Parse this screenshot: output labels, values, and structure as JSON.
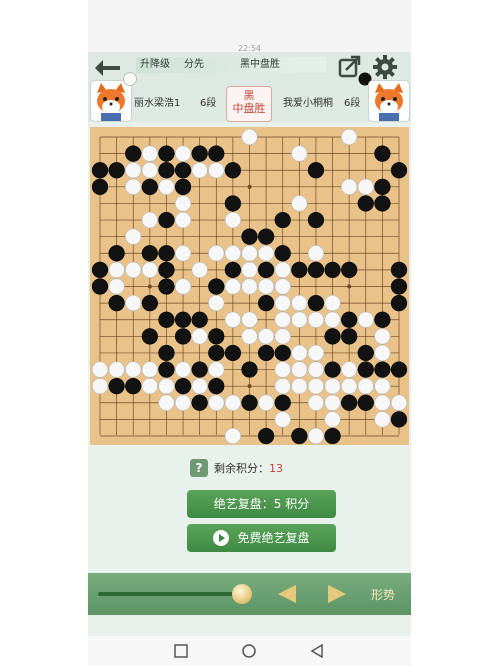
{
  "status": {
    "time": "22:54"
  },
  "header": {
    "rank_label": "升降级",
    "handicap": "分先",
    "result_top": "黑中盘胜",
    "left_player": {
      "name": "丽水梁浩1",
      "rank": "6段",
      "stone": "white"
    },
    "right_player": {
      "name": "我爱小桐桐",
      "rank": "6段",
      "stone": "black"
    },
    "result_stamp": {
      "line1": "黑",
      "line2": "中盘胜"
    },
    "icons": [
      "back-arrow-icon",
      "share-icon",
      "gear-icon",
      "fox-avatar-icon"
    ]
  },
  "board": {
    "size": 19,
    "colors": {
      "wood": "#e9c28a",
      "grid": "#6f4a26",
      "black": "#121212",
      "white": "#f7f7f7"
    },
    "rows": [
      ".........W.....W...",
      "..BWBWBB....W....B.",
      "BBWWBBWWB....B....B",
      "B.WBWB.........WWB.",
      ".....W..B...W...BB.",
      "...WBW..W..B.B.....",
      "..W......BB........",
      ".B.BBW.WWWWB.W.....",
      "BWWWB.W.BWBWBBBB..B",
      "BW..BW.BWWWW......B",
      ".BWB...W..BWWBW...B",
      "....BBB.WW.WWWWBWB.",
      "...B.BWB.WWW..BB.W.",
      "....B..BB.BBWW..BW.",
      "WWWWBWBW.B.WWWBWBBB",
      "WBBWWBWB...WWWWWWW.",
      "....WWBWWBWB.WWBBWW",
      "...........W..W..WB",
      "........W.B.BWB...."
    ],
    "last_move_star": "5-11"
  },
  "controls": {
    "help_icon": "?",
    "points_label": "剩余积分：",
    "points_value": "13",
    "replay_cost_label": "绝艺复盘：5 积分",
    "free_replay_label": "免费绝艺复盘",
    "play_icon": "play-icon"
  },
  "footer": {
    "slider_value": 1.0,
    "trend_label": "形势",
    "icons": [
      "slider-knob-icon",
      "prev-triangle-icon",
      "next-triangle-icon"
    ]
  },
  "navbar": {
    "icons": [
      "square-recent-icon",
      "circle-home-icon",
      "triangle-back-icon"
    ]
  }
}
